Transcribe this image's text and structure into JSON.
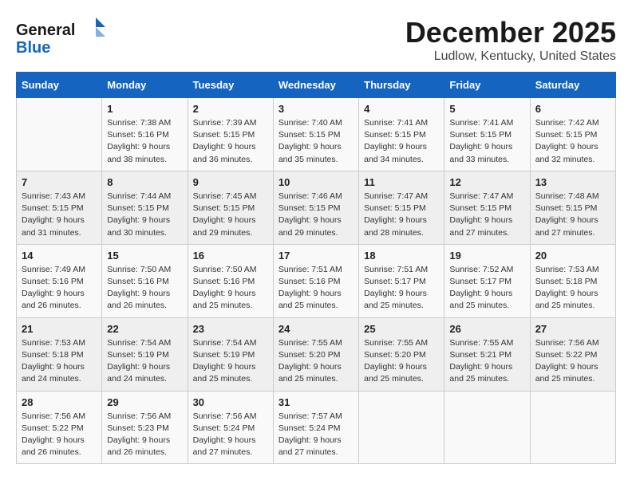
{
  "header": {
    "logo_general": "General",
    "logo_blue": "Blue",
    "month": "December 2025",
    "location": "Ludlow, Kentucky, United States"
  },
  "days_of_week": [
    "Sunday",
    "Monday",
    "Tuesday",
    "Wednesday",
    "Thursday",
    "Friday",
    "Saturday"
  ],
  "weeks": [
    [
      {
        "day": "",
        "info": ""
      },
      {
        "day": "1",
        "info": "Sunrise: 7:38 AM\nSunset: 5:16 PM\nDaylight: 9 hours\nand 38 minutes."
      },
      {
        "day": "2",
        "info": "Sunrise: 7:39 AM\nSunset: 5:15 PM\nDaylight: 9 hours\nand 36 minutes."
      },
      {
        "day": "3",
        "info": "Sunrise: 7:40 AM\nSunset: 5:15 PM\nDaylight: 9 hours\nand 35 minutes."
      },
      {
        "day": "4",
        "info": "Sunrise: 7:41 AM\nSunset: 5:15 PM\nDaylight: 9 hours\nand 34 minutes."
      },
      {
        "day": "5",
        "info": "Sunrise: 7:41 AM\nSunset: 5:15 PM\nDaylight: 9 hours\nand 33 minutes."
      },
      {
        "day": "6",
        "info": "Sunrise: 7:42 AM\nSunset: 5:15 PM\nDaylight: 9 hours\nand 32 minutes."
      }
    ],
    [
      {
        "day": "7",
        "info": "Sunrise: 7:43 AM\nSunset: 5:15 PM\nDaylight: 9 hours\nand 31 minutes."
      },
      {
        "day": "8",
        "info": "Sunrise: 7:44 AM\nSunset: 5:15 PM\nDaylight: 9 hours\nand 30 minutes."
      },
      {
        "day": "9",
        "info": "Sunrise: 7:45 AM\nSunset: 5:15 PM\nDaylight: 9 hours\nand 29 minutes."
      },
      {
        "day": "10",
        "info": "Sunrise: 7:46 AM\nSunset: 5:15 PM\nDaylight: 9 hours\nand 29 minutes."
      },
      {
        "day": "11",
        "info": "Sunrise: 7:47 AM\nSunset: 5:15 PM\nDaylight: 9 hours\nand 28 minutes."
      },
      {
        "day": "12",
        "info": "Sunrise: 7:47 AM\nSunset: 5:15 PM\nDaylight: 9 hours\nand 27 minutes."
      },
      {
        "day": "13",
        "info": "Sunrise: 7:48 AM\nSunset: 5:15 PM\nDaylight: 9 hours\nand 27 minutes."
      }
    ],
    [
      {
        "day": "14",
        "info": "Sunrise: 7:49 AM\nSunset: 5:16 PM\nDaylight: 9 hours\nand 26 minutes."
      },
      {
        "day": "15",
        "info": "Sunrise: 7:50 AM\nSunset: 5:16 PM\nDaylight: 9 hours\nand 26 minutes."
      },
      {
        "day": "16",
        "info": "Sunrise: 7:50 AM\nSunset: 5:16 PM\nDaylight: 9 hours\nand 25 minutes."
      },
      {
        "day": "17",
        "info": "Sunrise: 7:51 AM\nSunset: 5:16 PM\nDaylight: 9 hours\nand 25 minutes."
      },
      {
        "day": "18",
        "info": "Sunrise: 7:51 AM\nSunset: 5:17 PM\nDaylight: 9 hours\nand 25 minutes."
      },
      {
        "day": "19",
        "info": "Sunrise: 7:52 AM\nSunset: 5:17 PM\nDaylight: 9 hours\nand 25 minutes."
      },
      {
        "day": "20",
        "info": "Sunrise: 7:53 AM\nSunset: 5:18 PM\nDaylight: 9 hours\nand 25 minutes."
      }
    ],
    [
      {
        "day": "21",
        "info": "Sunrise: 7:53 AM\nSunset: 5:18 PM\nDaylight: 9 hours\nand 24 minutes."
      },
      {
        "day": "22",
        "info": "Sunrise: 7:54 AM\nSunset: 5:19 PM\nDaylight: 9 hours\nand 24 minutes."
      },
      {
        "day": "23",
        "info": "Sunrise: 7:54 AM\nSunset: 5:19 PM\nDaylight: 9 hours\nand 25 minutes."
      },
      {
        "day": "24",
        "info": "Sunrise: 7:55 AM\nSunset: 5:20 PM\nDaylight: 9 hours\nand 25 minutes."
      },
      {
        "day": "25",
        "info": "Sunrise: 7:55 AM\nSunset: 5:20 PM\nDaylight: 9 hours\nand 25 minutes."
      },
      {
        "day": "26",
        "info": "Sunrise: 7:55 AM\nSunset: 5:21 PM\nDaylight: 9 hours\nand 25 minutes."
      },
      {
        "day": "27",
        "info": "Sunrise: 7:56 AM\nSunset: 5:22 PM\nDaylight: 9 hours\nand 25 minutes."
      }
    ],
    [
      {
        "day": "28",
        "info": "Sunrise: 7:56 AM\nSunset: 5:22 PM\nDaylight: 9 hours\nand 26 minutes."
      },
      {
        "day": "29",
        "info": "Sunrise: 7:56 AM\nSunset: 5:23 PM\nDaylight: 9 hours\nand 26 minutes."
      },
      {
        "day": "30",
        "info": "Sunrise: 7:56 AM\nSunset: 5:24 PM\nDaylight: 9 hours\nand 27 minutes."
      },
      {
        "day": "31",
        "info": "Sunrise: 7:57 AM\nSunset: 5:24 PM\nDaylight: 9 hours\nand 27 minutes."
      },
      {
        "day": "",
        "info": ""
      },
      {
        "day": "",
        "info": ""
      },
      {
        "day": "",
        "info": ""
      }
    ]
  ]
}
